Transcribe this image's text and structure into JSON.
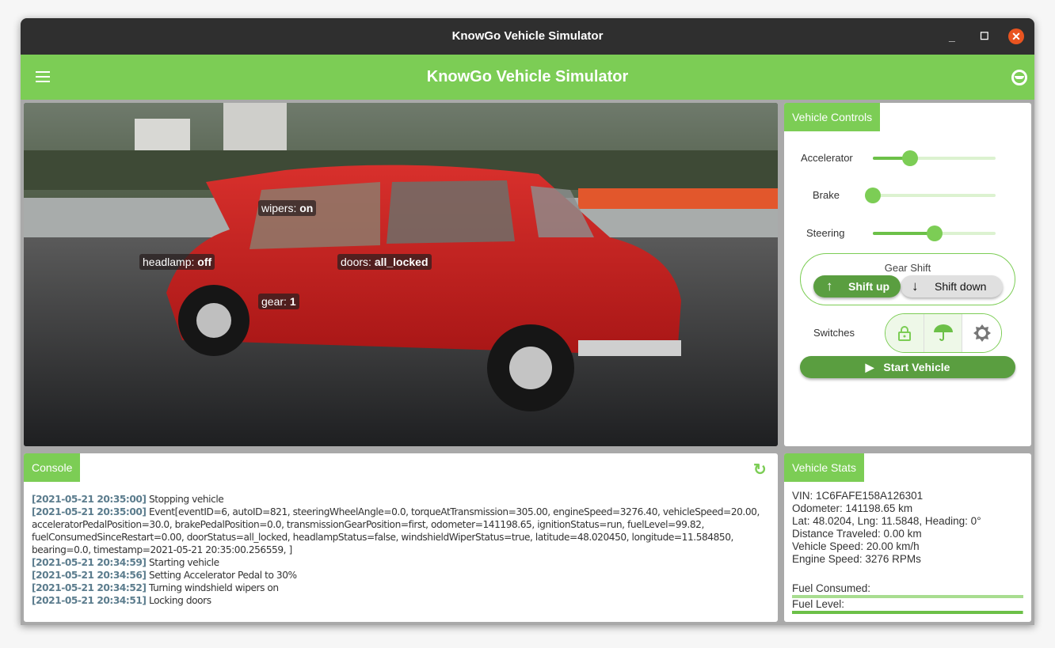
{
  "window": {
    "title": "KnowGo Vehicle Simulator",
    "minimize": "_",
    "maximize": "☐",
    "close": "✕"
  },
  "appbar": {
    "title": "KnowGo Vehicle Simulator",
    "menu_icon": "hamburger-icon",
    "right_icon": "steering-wheel-icon"
  },
  "overlay": {
    "wipers": {
      "label": "wipers:",
      "value": "on"
    },
    "headlamp": {
      "label": "headlamp:",
      "value": "off"
    },
    "doors": {
      "label": "doors:",
      "value": "all_locked"
    },
    "gear": {
      "label": "gear:",
      "value": "1"
    }
  },
  "controls": {
    "title": "Vehicle Controls",
    "accelerator": {
      "label": "Accelerator",
      "value_percent": 30
    },
    "brake": {
      "label": "Brake",
      "value_percent": 0
    },
    "steering": {
      "label": "Steering",
      "value_percent": 50
    },
    "gear_shift": {
      "label": "Gear Shift",
      "up": "Shift up",
      "down": "Shift down"
    },
    "switches": {
      "label": "Switches",
      "items": [
        {
          "icon": "lock-icon",
          "active": true
        },
        {
          "icon": "umbrella-icon",
          "active": true
        },
        {
          "icon": "headlamp-icon",
          "active": false
        }
      ]
    },
    "start": "Start Vehicle"
  },
  "console": {
    "title": "Console",
    "refresh_icon": "refresh-icon",
    "entries": [
      {
        "ts": "[2021-05-21 20:35:00]",
        "msg": "Stopping vehicle"
      },
      {
        "ts": "[2021-05-21 20:35:00]",
        "msg": "Event[eventID=6, autoID=821, steeringWheelAngle=0.0, torqueAtTransmission=305.00, engineSpeed=3276.40, vehicleSpeed=20.00, acceleratorPedalPosition=30.0, brakePedalPosition=0.0, transmissionGearPosition=first, odometer=141198.65, ignitionStatus=run, fuelLevel=99.82, fuelConsumedSinceRestart=0.00, doorStatus=all_locked, headlampStatus=false, windshieldWiperStatus=true, latitude=48.020450, longitude=11.584850, bearing=0.0, timestamp=2021-05-21 20:35:00.256559, ]"
      },
      {
        "ts": "[2021-05-21 20:34:59]",
        "msg": "Starting vehicle"
      },
      {
        "ts": "[2021-05-21 20:34:56]",
        "msg": "Setting Accelerator Pedal to 30%"
      },
      {
        "ts": "[2021-05-21 20:34:52]",
        "msg": "Turning windshield wipers on"
      },
      {
        "ts": "[2021-05-21 20:34:51]",
        "msg": "Locking doors"
      }
    ]
  },
  "stats": {
    "title": "Vehicle Stats",
    "vin": "VIN: 1C6FAFE158A126301",
    "odometer": "Odometer: 141198.65 km",
    "position": "Lat: 48.0204, Lng: 11.5848, Heading: 0°",
    "distance": "Distance Traveled: 0.00 km",
    "speed": "Vehicle Speed: 20.00 km/h",
    "engine": "Engine Speed: 3276 RPMs",
    "fuel_consumed_label": "Fuel Consumed:",
    "fuel_consumed_percent": 0,
    "fuel_level_label": "Fuel Level:",
    "fuel_level_percent": 99.82
  },
  "colors": {
    "accent": "#7ccd55",
    "accent_dark": "#5a9e40",
    "titlebar": "#2f2f2f",
    "close": "#e95420",
    "timestamp": "#5b7c8d"
  }
}
